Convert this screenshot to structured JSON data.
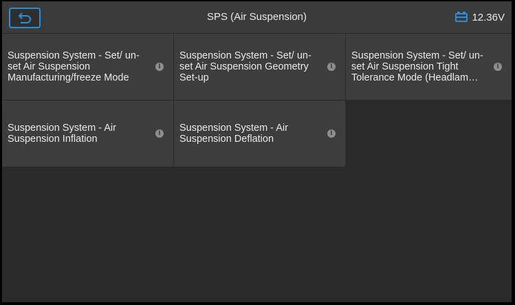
{
  "header": {
    "title": "SPS (Air Suspension)",
    "voltage": "12.36V",
    "back_icon": "back-arrow-icon",
    "battery_icon": "car-battery-icon",
    "accent_color": "#2b8fd8"
  },
  "functions": [
    {
      "label": "Suspension System - Set/ un-set Air Suspension Manufacturing/freeze Mode"
    },
    {
      "label": "Suspension System - Set/ un-set Air Suspension Geometry Set-up"
    },
    {
      "label": "Suspension System - Set/ un-set Air Suspension Tight Tolerance Mode (Headlam…"
    },
    {
      "label": "Suspension System - Air Suspension Inflation"
    },
    {
      "label": "Suspension System - Air Suspension Deflation"
    }
  ],
  "info_glyph": "i"
}
